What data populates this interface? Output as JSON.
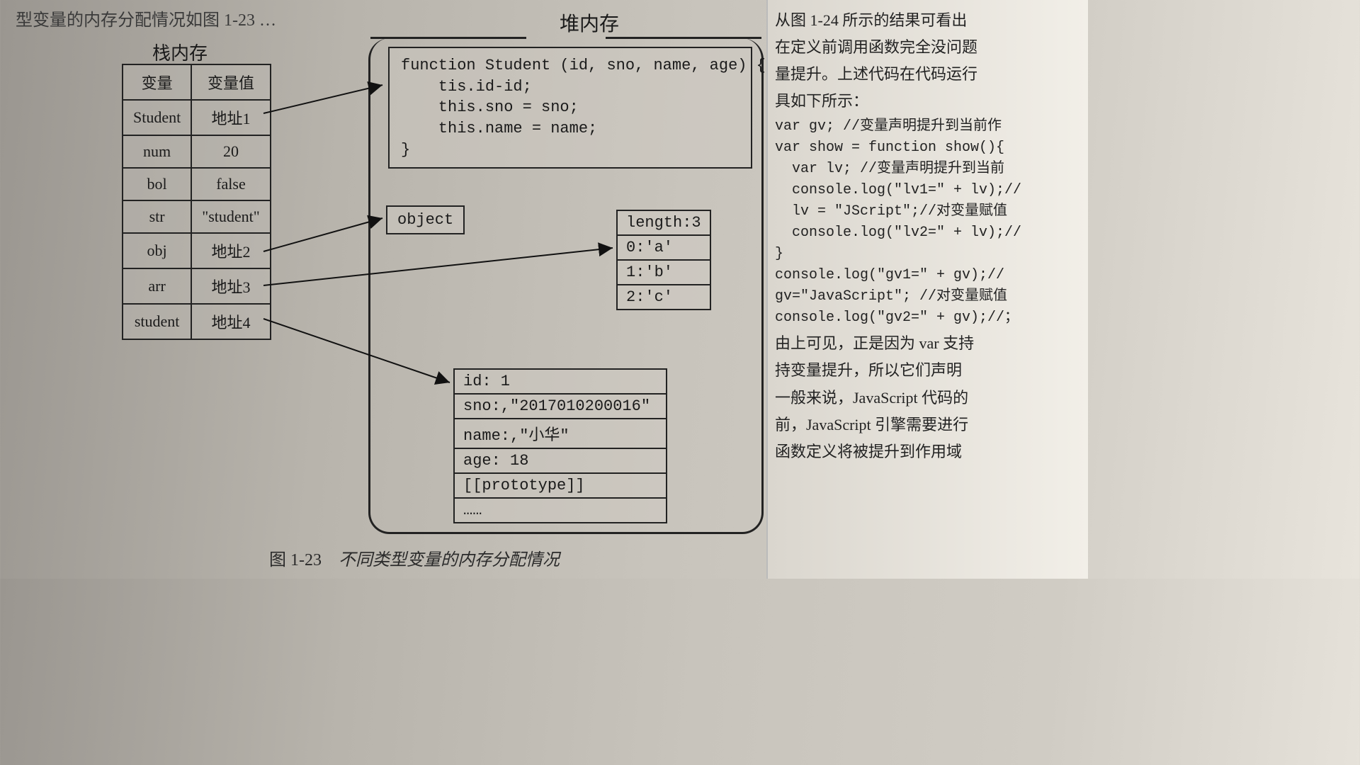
{
  "topText": "型变量的内存分配情况如图 1-23 …",
  "stackTitle": "栈内存",
  "heapTitle": "堆内存",
  "stackHeader": {
    "col1": "变量",
    "col2": "变量值"
  },
  "stackRows": [
    {
      "name": "Student",
      "value": "地址1"
    },
    {
      "name": "num",
      "value": "20"
    },
    {
      "name": "bol",
      "value": "false"
    },
    {
      "name": "str",
      "value": "\"student\""
    },
    {
      "name": "obj",
      "value": "地址2"
    },
    {
      "name": "arr",
      "value": "地址3"
    },
    {
      "name": "student",
      "value": "地址4"
    }
  ],
  "codeBox": "function Student (id, sno, name, age) {\n    tis.id-id;\n    this.sno = sno;\n    this.name = name;\n}",
  "objectLabel": "object",
  "arrayRows": [
    "length:3",
    "0:'a'",
    "1:'b'",
    "2:'c'"
  ],
  "studentRows": [
    "id: 1",
    "sno:,\"2017010200016\"",
    "name:,\"小华\"",
    "age: 18",
    "[[prototype]]",
    "……"
  ],
  "caption": {
    "fig": "图 1-23",
    "text": "不同类型变量的内存分配情况"
  },
  "rightPage": {
    "p1": "从图 1-24 所示的结果可看出",
    "p2": "在定义前调用函数完全没问题",
    "p3": "量提升。上述代码在代码运行",
    "p4": "具如下所示：",
    "code1": "var gv; //变量声明提升到当前作",
    "code2": "var show = function show(){",
    "code3": "  var lv; //变量声明提升到当前",
    "code4": "  console.log(\"lv1=\" + lv);//",
    "code5": "  lv = \"JScript\";//对变量赋值",
    "code6": "  console.log(\"lv2=\" + lv);//",
    "code7": "}",
    "code8": "console.log(\"gv1=\" + gv);//",
    "code9": "gv=\"JavaScript\"; //对变量赋值",
    "code10": "console.log(\"gv2=\" + gv);//；",
    "p5": "由上可见，正是因为 var 支持",
    "p6": "持变量提升，所以它们声明",
    "p7": "一般来说，JavaScript 代码的",
    "p8": "前，JavaScript 引擎需要进行",
    "p9": "函数定义将被提升到作用域"
  }
}
